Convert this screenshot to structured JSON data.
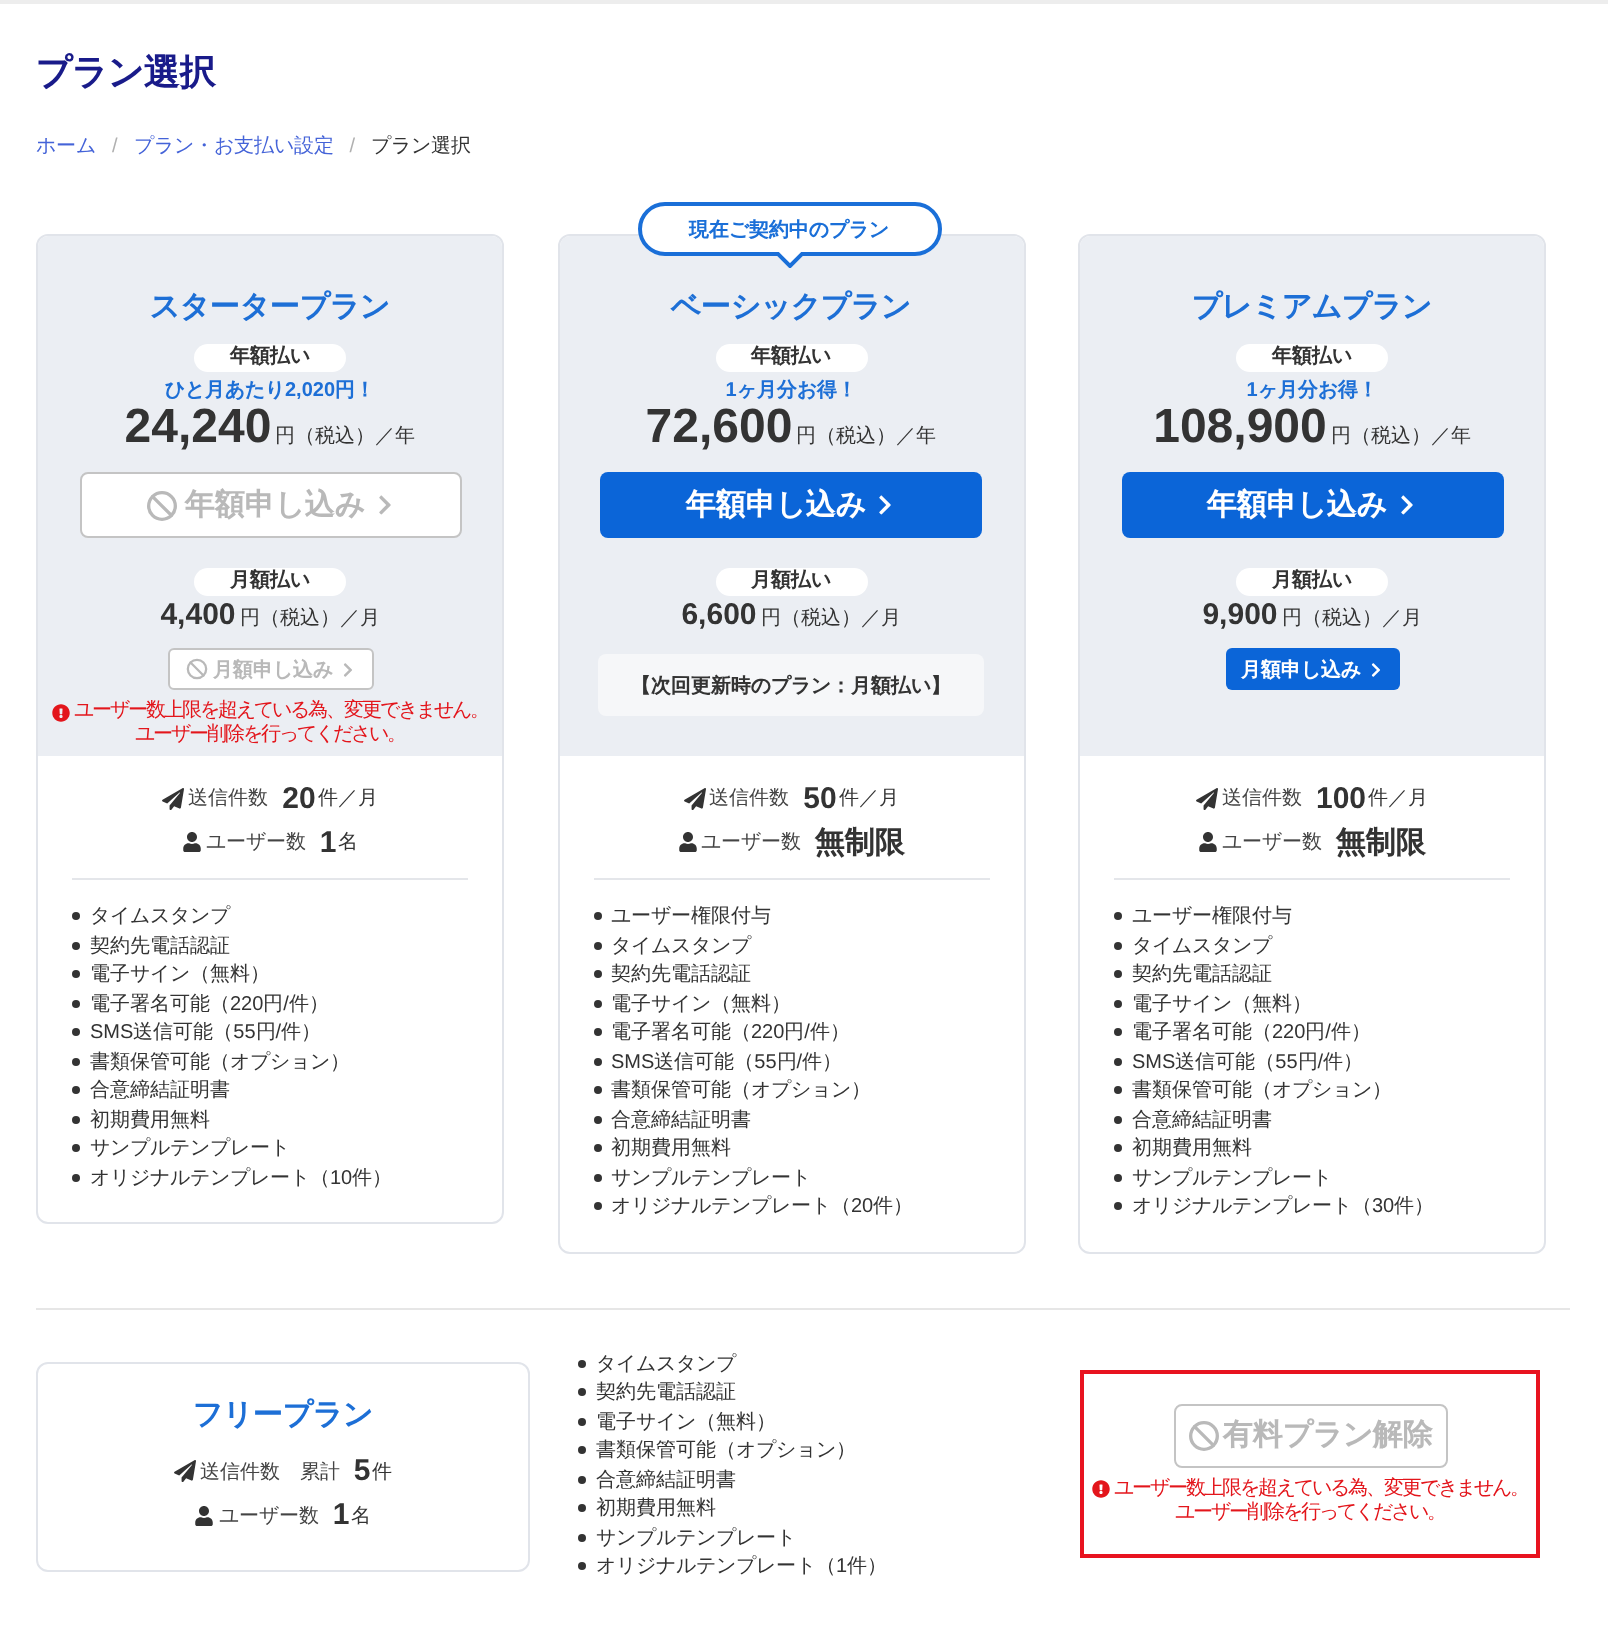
{
  "page": {
    "title": "プラン選択"
  },
  "breadcrumb": [
    {
      "kind": "link",
      "label": "ホーム"
    },
    {
      "kind": "separator",
      "label": "/"
    },
    {
      "kind": "link",
      "label": "プラン・お支払い設定"
    },
    {
      "kind": "separator",
      "label": "/"
    },
    {
      "kind": "current",
      "label": "プラン選択"
    }
  ],
  "plans": [
    {
      "name": "スタータープラン",
      "annual": {
        "label": "年額払い",
        "note": "ひと月あたり2,020円！",
        "price": "24,240",
        "unit": "円（税込）／年",
        "button": {
          "label": "年額申し込み",
          "disabled": true
        }
      },
      "monthly": {
        "label": "月額払い",
        "price": "4,400",
        "unit": "円（税込）／月",
        "action": {
          "kind": "button",
          "label": "月額申し込み",
          "disabled": true
        }
      },
      "errors": [
        "ユーザー数上限を超えている為、変更できません。",
        "ユーザー削除を行ってください。"
      ],
      "stats": [
        {
          "kind": "send",
          "label": "送信件数",
          "value": "20",
          "unit": "件／月"
        },
        {
          "kind": "users",
          "label": "ユーザー数",
          "value": "1",
          "unit": "名"
        }
      ],
      "features": [
        "タイムスタンプ",
        "契約先電話認証",
        "電子サイン（無料）",
        "電子署名可能（220円/件）",
        "SMS送信可能（55円/件）",
        "書類保管可能（オプション）",
        "合意締結証明書",
        "初期費用無料",
        "サンプルテンプレート",
        "オリジナルテンプレート（10件）"
      ]
    },
    {
      "name": "ベーシックプラン",
      "badge": "現在ご契約中のプラン",
      "annual": {
        "label": "年額払い",
        "note": "1ヶ月分お得！",
        "price": "72,600",
        "unit": "円（税込）／年",
        "button": {
          "label": "年額申し込み",
          "disabled": false
        }
      },
      "monthly": {
        "label": "月額払い",
        "price": "6,600",
        "unit": "円（税込）／月",
        "action": {
          "kind": "note",
          "text": "【次回更新時のプラン：月額払い】"
        }
      },
      "stats": [
        {
          "kind": "send",
          "label": "送信件数",
          "value": "50",
          "unit": "件／月"
        },
        {
          "kind": "users",
          "label": "ユーザー数",
          "value": "無制限"
        }
      ],
      "features": [
        "ユーザー権限付与",
        "タイムスタンプ",
        "契約先電話認証",
        "電子サイン（無料）",
        "電子署名可能（220円/件）",
        "SMS送信可能（55円/件）",
        "書類保管可能（オプション）",
        "合意締結証明書",
        "初期費用無料",
        "サンプルテンプレート",
        "オリジナルテンプレート（20件）"
      ]
    },
    {
      "name": "プレミアムプラン",
      "annual": {
        "label": "年額払い",
        "note": "1ヶ月分お得！",
        "price": "108,900",
        "unit": "円（税込）／年",
        "button": {
          "label": "年額申し込み",
          "disabled": false
        }
      },
      "monthly": {
        "label": "月額払い",
        "price": "9,900",
        "unit": "円（税込）／月",
        "action": {
          "kind": "button",
          "label": "月額申し込み",
          "disabled": false
        }
      },
      "stats": [
        {
          "kind": "send",
          "label": "送信件数",
          "value": "100",
          "unit": "件／月"
        },
        {
          "kind": "users",
          "label": "ユーザー数",
          "value": "無制限"
        }
      ],
      "features": [
        "ユーザー権限付与",
        "タイムスタンプ",
        "契約先電話認証",
        "電子サイン（無料）",
        "電子署名可能（220円/件）",
        "SMS送信可能（55円/件）",
        "書類保管可能（オプション）",
        "合意締結証明書",
        "初期費用無料",
        "サンプルテンプレート",
        "オリジナルテンプレート（30件）"
      ]
    }
  ],
  "free_plan": {
    "name": "フリープラン",
    "stats": [
      {
        "kind": "send",
        "label": "送信件数",
        "qualifier": "累計",
        "value": "5",
        "unit": "件"
      },
      {
        "kind": "users",
        "label": "ユーザー数",
        "value": "1",
        "unit": "名"
      }
    ],
    "features": [
      "タイムスタンプ",
      "契約先電話認証",
      "電子サイン（無料）",
      "書類保管可能（オプション）",
      "合意締結証明書",
      "初期費用無料",
      "サンプルテンプレート",
      "オリジナルテンプレート（1件）"
    ],
    "cancel": {
      "label": "有料プラン解除",
      "disabled": true,
      "highlighted": true,
      "errors": [
        "ユーザー数上限を超えている為、変更できません。",
        "ユーザー削除を行ってください。"
      ]
    }
  }
}
